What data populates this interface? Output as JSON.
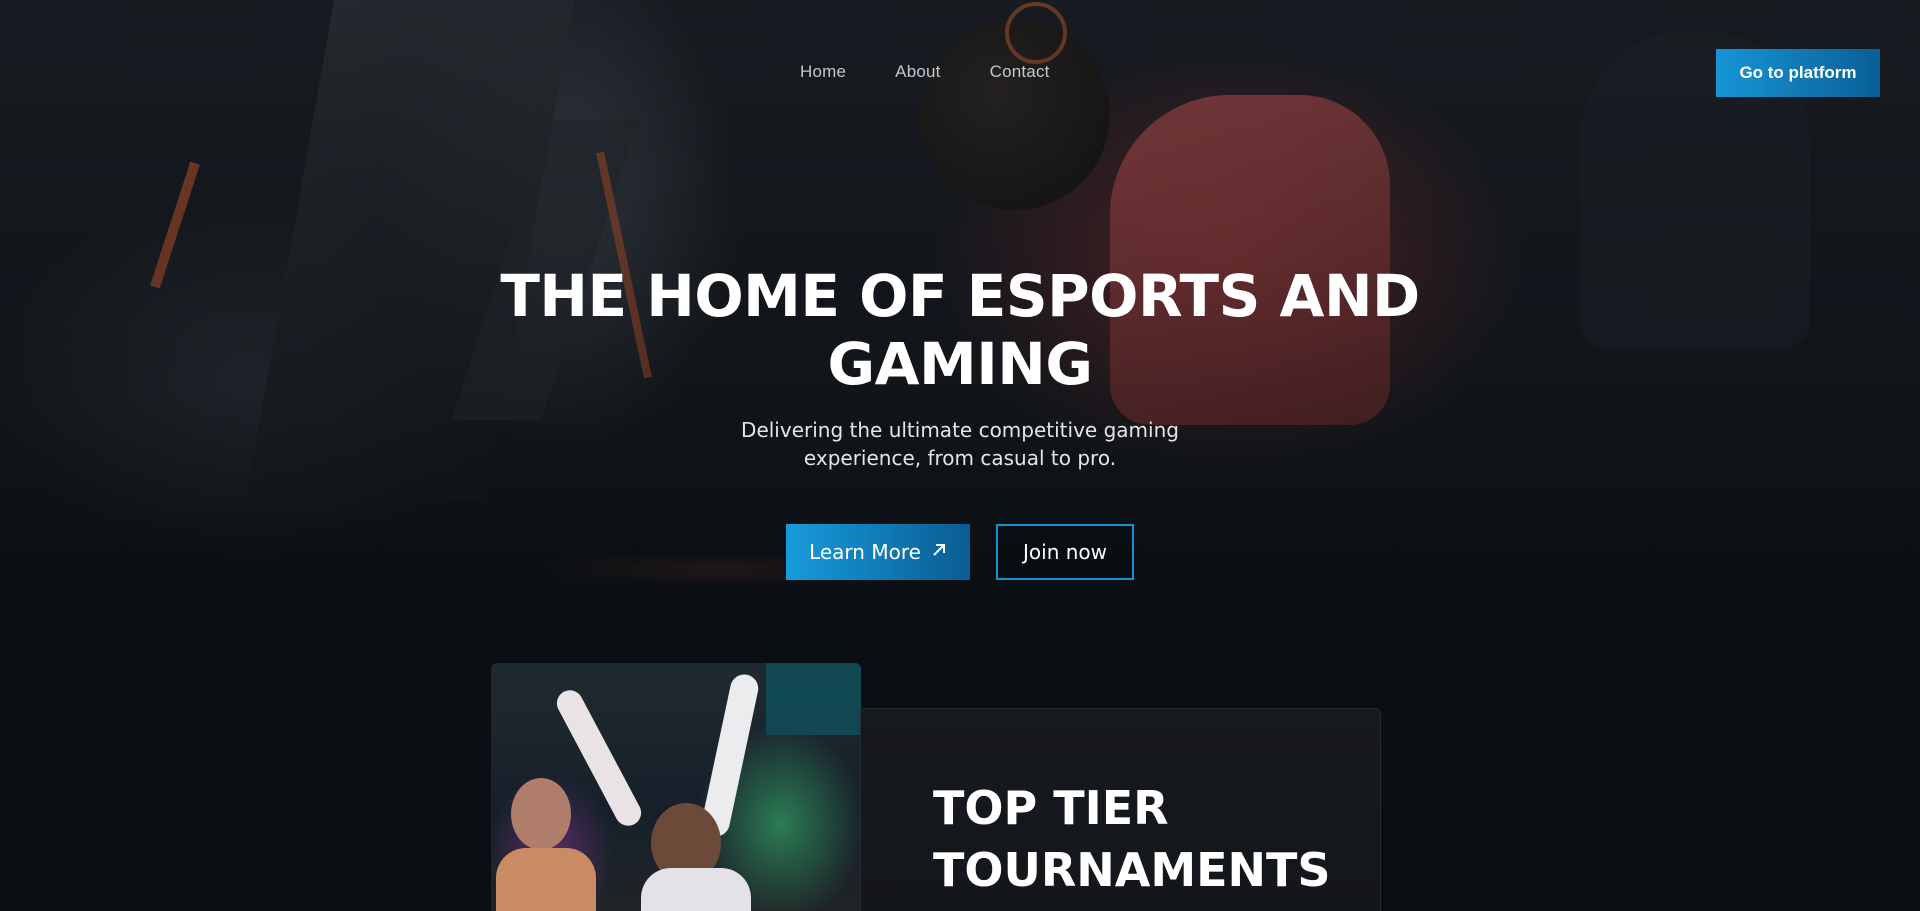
{
  "nav": {
    "items": [
      {
        "label": "Home"
      },
      {
        "label": "About"
      },
      {
        "label": "Contact"
      }
    ],
    "cta_label": "Go to platform"
  },
  "hero": {
    "title": "THE HOME OF ESPORTS AND GAMING",
    "subtitle": "Delivering the ultimate competitive gaming experience, from casual to pro.",
    "primary_button": {
      "label": "Learn More",
      "icon": "arrow-up-right-icon"
    },
    "secondary_button": {
      "label": "Join now"
    }
  },
  "feature": {
    "title": "TOP TIER TOURNAMENTS"
  },
  "colors": {
    "accent_blue": "#1795d6",
    "accent_blue_dark": "#0a5f95",
    "background": "#0b0f13"
  }
}
